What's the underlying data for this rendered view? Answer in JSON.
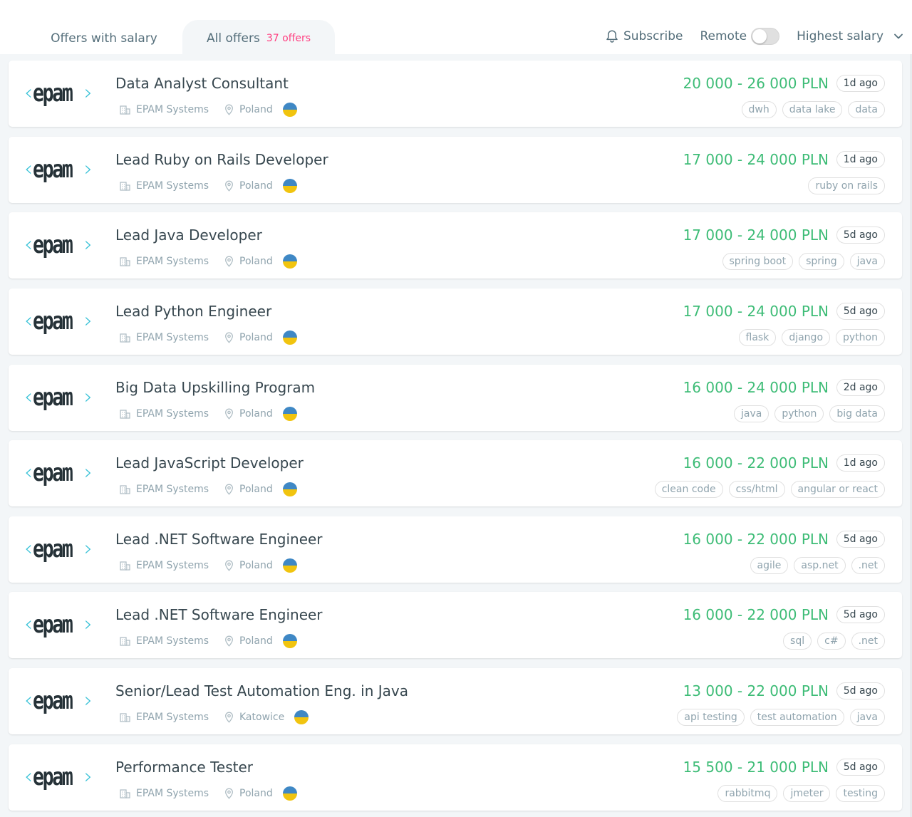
{
  "tabs": {
    "salary_label": "Offers with salary",
    "all_label": "All offers",
    "all_count": "37 offers"
  },
  "controls": {
    "subscribe_label": "Subscribe",
    "remote_label": "Remote",
    "sort_label": "Highest salary"
  },
  "brand": {
    "logo_text": "epam"
  },
  "colors": {
    "salary": "#3dbc76",
    "count": "#ff4081",
    "logo_accent": "#39c2d7"
  },
  "offers": [
    {
      "title": "Data Analyst Consultant",
      "company": "EPAM Systems",
      "location": "Poland",
      "salary": "20 000 - 26 000 PLN",
      "age": "1d ago",
      "tags": [
        "dwh",
        "data lake",
        "data"
      ]
    },
    {
      "title": "Lead Ruby on Rails Developer",
      "company": "EPAM Systems",
      "location": "Poland",
      "salary": "17 000 - 24 000 PLN",
      "age": "1d ago",
      "tags": [
        "ruby on rails"
      ]
    },
    {
      "title": "Lead Java Developer",
      "company": "EPAM Systems",
      "location": "Poland",
      "salary": "17 000 - 24 000 PLN",
      "age": "5d ago",
      "tags": [
        "spring boot",
        "spring",
        "java"
      ]
    },
    {
      "title": "Lead Python Engineer",
      "company": "EPAM Systems",
      "location": "Poland",
      "salary": "17 000 - 24 000 PLN",
      "age": "5d ago",
      "tags": [
        "flask",
        "django",
        "python"
      ]
    },
    {
      "title": "Big Data Upskilling Program",
      "company": "EPAM Systems",
      "location": "Poland",
      "salary": "16 000 - 24 000 PLN",
      "age": "2d ago",
      "tags": [
        "java",
        "python",
        "big data"
      ]
    },
    {
      "title": "Lead JavaScript Developer",
      "company": "EPAM Systems",
      "location": "Poland",
      "salary": "16 000 - 22 000 PLN",
      "age": "1d ago",
      "tags": [
        "clean code",
        "css/html",
        "angular or react"
      ]
    },
    {
      "title": "Lead .NET Software Engineer",
      "company": "EPAM Systems",
      "location": "Poland",
      "salary": "16 000 - 22 000 PLN",
      "age": "5d ago",
      "tags": [
        "agile",
        "asp.net",
        ".net"
      ]
    },
    {
      "title": "Lead .NET Software Engineer",
      "company": "EPAM Systems",
      "location": "Poland",
      "salary": "16 000 - 22 000 PLN",
      "age": "5d ago",
      "tags": [
        "sql",
        "c#",
        ".net"
      ]
    },
    {
      "title": "Senior/Lead Test Automation Eng. in Java",
      "company": "EPAM Systems",
      "location": "Katowice",
      "salary": "13 000 - 22 000 PLN",
      "age": "5d ago",
      "tags": [
        "api testing",
        "test automation",
        "java"
      ]
    },
    {
      "title": "Performance Tester",
      "company": "EPAM Systems",
      "location": "Poland",
      "salary": "15 500 - 21 000 PLN",
      "age": "5d ago",
      "tags": [
        "rabbitmq",
        "jmeter",
        "testing"
      ]
    }
  ]
}
